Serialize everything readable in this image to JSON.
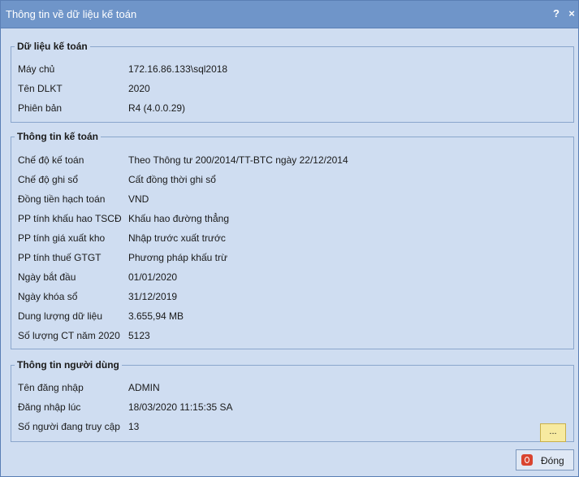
{
  "window": {
    "title": "Thông tin về dữ liệu kế toán",
    "help": "?",
    "close": "×"
  },
  "accounting_data": {
    "title": "Dữ liệu kế toán",
    "rows": [
      {
        "label": "Máy chủ",
        "value": "172.16.86.133\\sql2018"
      },
      {
        "label": "Tên DLKT",
        "value": "2020"
      },
      {
        "label": "Phiên bản",
        "value": "R4 (4.0.0.29)"
      }
    ]
  },
  "accounting_info": {
    "title": "Thông tin kế toán",
    "rows": [
      {
        "label": "Chế độ kế toán",
        "value": "Theo Thông tư 200/2014/TT-BTC ngày 22/12/2014"
      },
      {
        "label": "Chế độ ghi sổ",
        "value": "Cất đồng thời ghi sổ"
      },
      {
        "label": "Đồng tiền hạch toán",
        "value": "VND"
      },
      {
        "label": "PP tính khấu hao TSCĐ",
        "value": "Khấu hao đường thẳng"
      },
      {
        "label": "PP tính giá xuất kho",
        "value": "Nhập trước xuất trước"
      },
      {
        "label": "PP tính thuế GTGT",
        "value": "Phương pháp khấu trừ"
      },
      {
        "label": "Ngày bắt đầu",
        "value": "01/01/2020"
      },
      {
        "label": "Ngày khóa sổ",
        "value": "31/12/2019"
      },
      {
        "label": "Dung lượng dữ liệu",
        "value": "3.655,94 MB"
      },
      {
        "label": "Số lượng CT năm 2020",
        "value": "5123"
      }
    ]
  },
  "user_info": {
    "title": "Thông tin người dùng",
    "rows": [
      {
        "label": "Tên đăng nhập",
        "value": "ADMIN"
      },
      {
        "label": "Đăng nhập lúc",
        "value": "18/03/2020 11:15:35 SA"
      },
      {
        "label": "Số người đang truy cập",
        "value": "13"
      }
    ],
    "more_button": "..."
  },
  "footer": {
    "close_label": "Đóng"
  }
}
